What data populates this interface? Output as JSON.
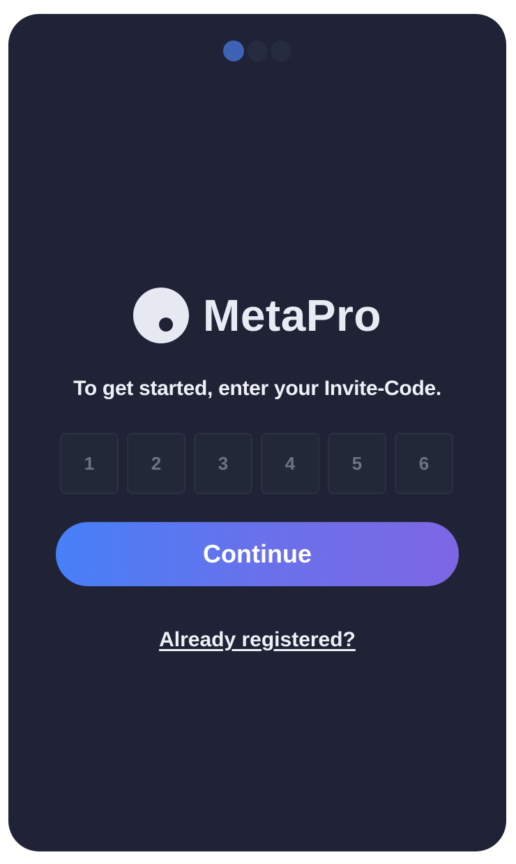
{
  "progress": {
    "total_steps": 3,
    "current_step": 1,
    "active_color": "#3d63b6",
    "inactive_color": "#262b3f"
  },
  "brand": {
    "name": "MetaPro",
    "logo_icon": "eye-circle-icon"
  },
  "invite": {
    "prompt": "To get started, enter your Invite-Code.",
    "code_placeholders": [
      "1",
      "2",
      "3",
      "4",
      "5",
      "6"
    ]
  },
  "actions": {
    "continue_label": "Continue",
    "already_registered_label": "Already registered?"
  },
  "colors": {
    "background": "#1f2335",
    "button_gradient_start": "#4680f8",
    "button_gradient_end": "#7d66e4"
  }
}
